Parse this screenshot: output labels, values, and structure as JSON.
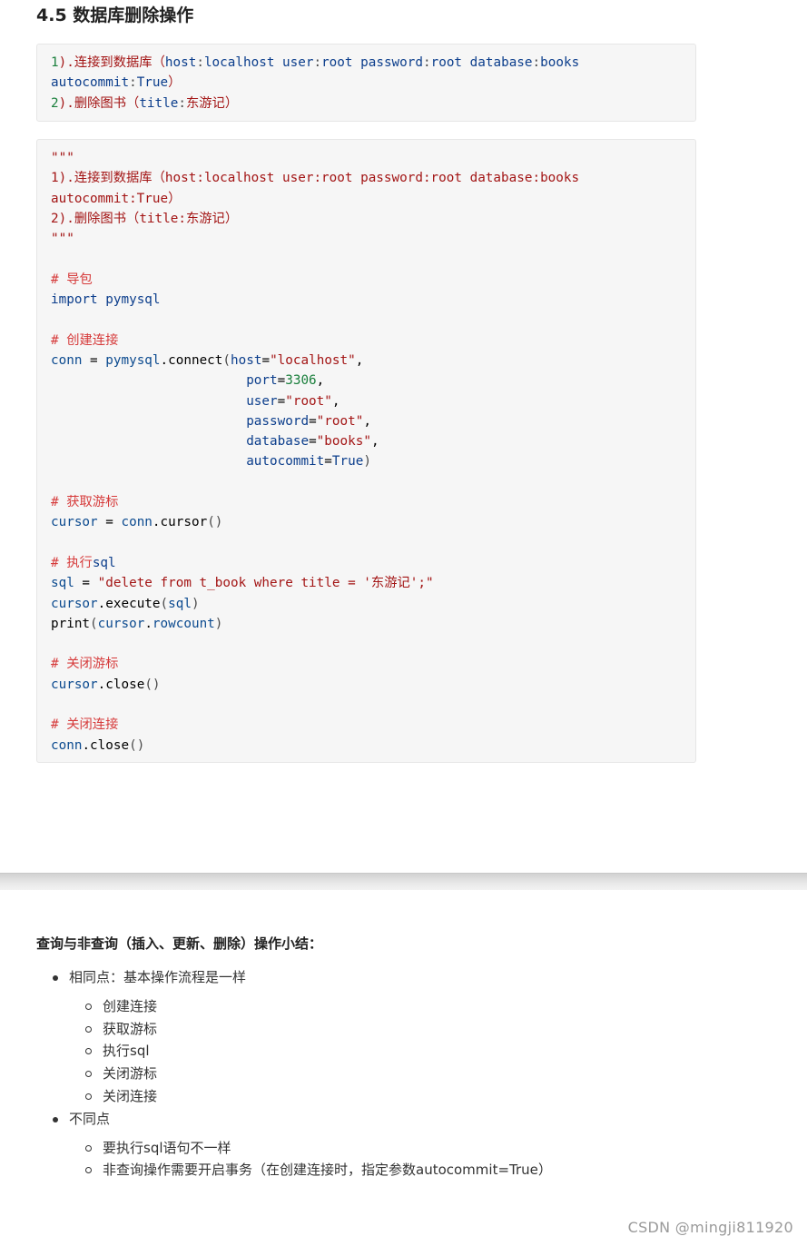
{
  "heading": "4.5 数据库删除操作",
  "task_box": {
    "line1": [
      "1",
      ").连接到数据库（",
      "host",
      ":",
      "localhost ",
      "user",
      ":",
      "root ",
      "password",
      ":",
      "root ",
      "database",
      ":",
      "books"
    ],
    "line2": [
      "autocommit",
      ":",
      "True",
      "）"
    ],
    "line3": [
      "2",
      ").删除图书（",
      "title",
      ":",
      "东游记",
      "）"
    ]
  },
  "code": {
    "doc_open": "\"\"\"",
    "doc_line1": [
      "1",
      ").连接到数据库（",
      "host:localhost user:root password:root database:books"
    ],
    "doc_line2": "autocommit:True）",
    "doc_line3": [
      "2",
      ").删除图书（",
      "title:",
      "东游记）"
    ],
    "doc_close": "\"\"\"",
    "c_import": "# 导包",
    "import_kw": "import",
    "import_mod": " pymysql",
    "c_connect": "# 创建连接",
    "conn_var": "conn",
    "eq": " = ",
    "pymysql": "pymysql",
    "dot": ".",
    "connect_fn": "connect",
    "paren_open": "(",
    "host_kw": "host",
    "host_val": "\"localhost\"",
    "port_kw": "port",
    "port_val": "3306",
    "user_kw": "user",
    "user_val": "\"root\"",
    "password_kw": "password",
    "password_val": "\"root\"",
    "database_kw": "database",
    "database_val": "\"books\"",
    "autocommit_kw": "autocommit",
    "autocommit_val": "True",
    "paren_close": ")",
    "comma": ",",
    "assign": "=",
    "c_cursor": "# 获取游标",
    "cursor_var": "cursor",
    "cursor_fn": "cursor",
    "call_empty": "()",
    "c_exec": "# 执行",
    "c_exec_sql": "sql",
    "sql_var": "sql",
    "sql_str": "\"delete from t_book where title = '东游记';\"",
    "execute_fn": "execute",
    "print_fn": "print",
    "rowcount": "rowcount",
    "c_close_cursor": "# 关闭游标",
    "close_fn": "close",
    "c_close_conn": "# 关闭连接"
  },
  "summary": {
    "title": "查询与非查询（插入、更新、删除）操作小结：",
    "items": [
      {
        "label": "相同点：基本操作流程是一样",
        "sub": [
          "创建连接",
          "获取游标",
          "执行sql",
          "关闭游标",
          "关闭连接"
        ]
      },
      {
        "label": "不同点",
        "sub": [
          "要执行sql语句不一样",
          "非查询操作需要开启事务（在创建连接时，指定参数autocommit=True）"
        ]
      }
    ]
  },
  "watermark": "CSDN @mingji811920",
  "colors": {
    "string": "#a31515",
    "keyword": "#0c3e8c",
    "number": "#1a7f3c",
    "comment": "#d63b3b",
    "code_bg": "#f6f6f6"
  }
}
